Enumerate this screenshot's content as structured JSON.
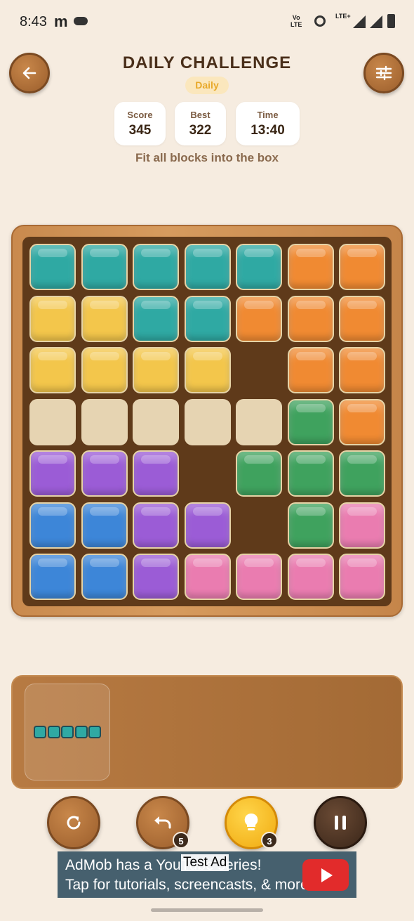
{
  "status_bar": {
    "time": "8:43",
    "carrier_glyph": "m",
    "volte": "Vo\nLTE",
    "lte": "LTE+",
    "icons": [
      "cloud-icon",
      "hotspot-icon",
      "signal-icon",
      "battery-icon"
    ]
  },
  "header": {
    "title": "DAILY CHALLENGE",
    "badge": "Daily",
    "back_icon": "arrow-left-icon",
    "settings_icon": "sliders-icon"
  },
  "stats": [
    {
      "label": "Score",
      "value": "345"
    },
    {
      "label": "Best",
      "value": "322"
    },
    {
      "label": "Time",
      "value": "13:40"
    }
  ],
  "hint": "Fit all blocks into the box",
  "colors": {
    "teal": "#2fa9a3",
    "orange": "#f08a32",
    "yellow": "#f3c64b",
    "green": "#3fa25e",
    "purple": "#9b5cd6",
    "blue": "#3d86d8",
    "pink": "#ea7cb0",
    "empty": "#e6d4b2"
  },
  "board": {
    "rows": 7,
    "cols": 7,
    "grid": [
      [
        "teal",
        "teal",
        "teal",
        "teal",
        "teal",
        "orange",
        "orange"
      ],
      [
        "yellow",
        "yellow",
        "teal",
        "teal",
        "orange",
        "orange",
        "orange"
      ],
      [
        "yellow",
        "yellow",
        "yellow",
        "yellow",
        "",
        "orange",
        "orange"
      ],
      [
        "slot",
        "slot",
        "slot",
        "slot",
        "slot",
        "green",
        "orange"
      ],
      [
        "purple",
        "purple",
        "purple",
        "",
        "green",
        "green",
        "green"
      ],
      [
        "blue",
        "blue",
        "purple",
        "purple",
        "",
        "green",
        "pink"
      ],
      [
        "blue",
        "blue",
        "purple",
        "pink",
        "pink",
        "pink",
        "pink"
      ]
    ]
  },
  "tray": {
    "pieces": [
      {
        "shape": "1x5-horizontal",
        "color": "teal",
        "cells": 5
      }
    ]
  },
  "controls": [
    {
      "name": "restart-button",
      "icon": "refresh-icon",
      "count": null
    },
    {
      "name": "undo-button",
      "icon": "undo-icon",
      "count": "5"
    },
    {
      "name": "hint-button",
      "icon": "lightbulb-icon",
      "count": "3"
    },
    {
      "name": "pause-button",
      "icon": "pause-icon",
      "count": null
    }
  ],
  "ad": {
    "line1": "AdMob has a YouTube series!",
    "line2": "Tap for tutorials, screencasts, & more.",
    "label": "Test Ad",
    "icon": "youtube-play-icon"
  }
}
